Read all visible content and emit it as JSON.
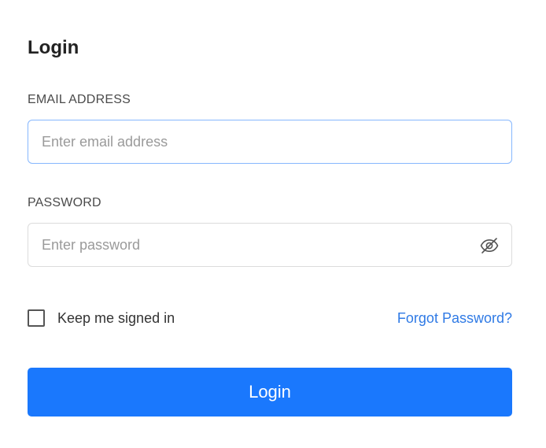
{
  "form": {
    "title": "Login",
    "email": {
      "label": "EMAIL ADDRESS",
      "placeholder": "Enter email address",
      "value": ""
    },
    "password": {
      "label": "PASSWORD",
      "placeholder": "Enter password",
      "value": "",
      "toggle_icon": "eye-slash-icon"
    },
    "keep_signed_in": {
      "label": "Keep me signed in",
      "checked": false
    },
    "forgot_password_label": "Forgot Password?",
    "submit_label": "Login"
  },
  "colors": {
    "accent": "#1a78fd",
    "link": "#2f7ae5",
    "focus_border": "#86b7fe",
    "border": "#dcdcdc",
    "text": "#222222"
  }
}
